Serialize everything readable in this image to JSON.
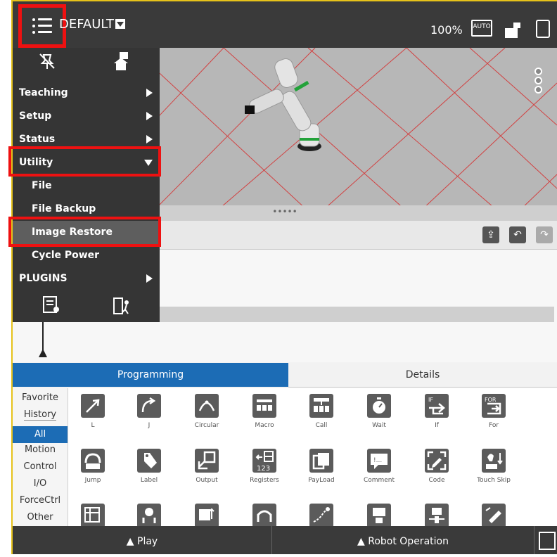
{
  "header": {
    "program_name": "DEFAULT",
    "zoom": "100%",
    "mode_badge": "AUTO",
    "icons": [
      "menu-icon",
      "auto-mode-icon",
      "teach-pendant-icon",
      "touch-icon"
    ]
  },
  "menu": {
    "top_icons": [
      "unpin-icon",
      "network-home-icon"
    ],
    "items": [
      {
        "label": "Teaching",
        "arrow": "right"
      },
      {
        "label": "Setup",
        "arrow": "right"
      },
      {
        "label": "Status",
        "arrow": "right"
      },
      {
        "label": "Utility",
        "arrow": "down"
      },
      {
        "label": "File",
        "sub": true
      },
      {
        "label": "File Backup",
        "sub": true
      },
      {
        "label": "Image Restore",
        "sub": true,
        "selected": true
      },
      {
        "label": "Cycle Power",
        "sub": true
      },
      {
        "label": "PLUGINS",
        "arrow": "right"
      }
    ],
    "bottom_icons": [
      "user-document-icon",
      "exit-icon"
    ]
  },
  "splitter": "•••••",
  "tabs": {
    "programming": "Programming",
    "details": "Details"
  },
  "categories": [
    "Favorite",
    "History",
    "All",
    "Motion",
    "Control",
    "I/O",
    "ForceCtrl",
    "Other"
  ],
  "active_category": "All",
  "palette": {
    "row1": [
      "L",
      "J",
      "Circular",
      "Macro",
      "Call",
      "Wait",
      "If",
      "For"
    ],
    "row2": [
      "Jump",
      "Label",
      "Output",
      "Registers",
      "PayLoad",
      "Comment",
      "Code",
      "Touch Skip"
    ],
    "glyph_if": "IF",
    "glyph_for": "FOR",
    "glyph_regs": "123",
    "glyph_comment": "!..."
  },
  "bottom": {
    "play": "▲ Play",
    "robot_operation": "▲ Robot Operation"
  },
  "colors": {
    "accent_blue": "#1c6cb5",
    "highlight_red": "#ee1111",
    "frame_yellow": "#e6c21a",
    "dark_bar": "#3a3a3a"
  }
}
